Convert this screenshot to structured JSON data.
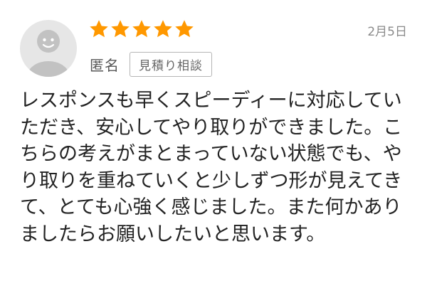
{
  "review": {
    "rating": 5,
    "rating_max": 5,
    "date": "2月5日",
    "reviewer_name": "匿名",
    "tag": "見積り相談",
    "body": "レスポンスも早くスピーディーに対応していただき、安心してやり取りができました。こちらの考えがまとまっていない状態でも、やり取りを重ねていくと少しずつ形が見えてきて、とても心強く感じました。また何かありましたらお願いしたいと思います。"
  },
  "colors": {
    "star": "#ff9800",
    "avatar_bg": "#e6e6e6",
    "avatar_figure": "#c2c2c2"
  }
}
